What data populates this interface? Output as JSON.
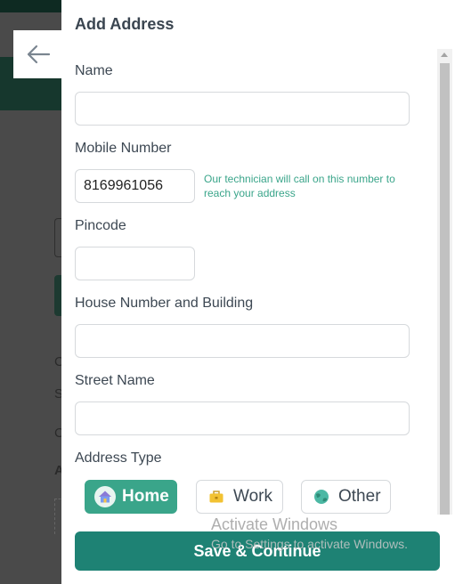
{
  "background": {
    "fragments": [
      "C",
      "S",
      "C",
      "A"
    ]
  },
  "modal": {
    "title": "Add Address",
    "fields": {
      "name": {
        "label": "Name",
        "value": "",
        "placeholder": ""
      },
      "mobile": {
        "label": "Mobile Number",
        "value": "8169961056",
        "placeholder": "",
        "hint": "Our technician will call on this number to reach your address"
      },
      "pincode": {
        "label": "Pincode",
        "value": "",
        "placeholder": ""
      },
      "house": {
        "label": "House Number and Building",
        "value": "",
        "placeholder": ""
      },
      "street": {
        "label": "Street Name",
        "value": "",
        "placeholder": ""
      }
    },
    "address_type": {
      "label": "Address Type",
      "options": [
        {
          "label": "Home",
          "icon": "home-icon",
          "selected": true
        },
        {
          "label": "Work",
          "icon": "briefcase-icon",
          "selected": false
        },
        {
          "label": "Other",
          "icon": "globe-icon",
          "selected": false
        }
      ]
    },
    "save_button": "Save & Continue"
  },
  "watermark": {
    "line1": "Activate Windows",
    "line2": "Go to Settings to activate Windows."
  },
  "colors": {
    "accent": "#3aa58a",
    "primary_button": "#1e8274"
  }
}
